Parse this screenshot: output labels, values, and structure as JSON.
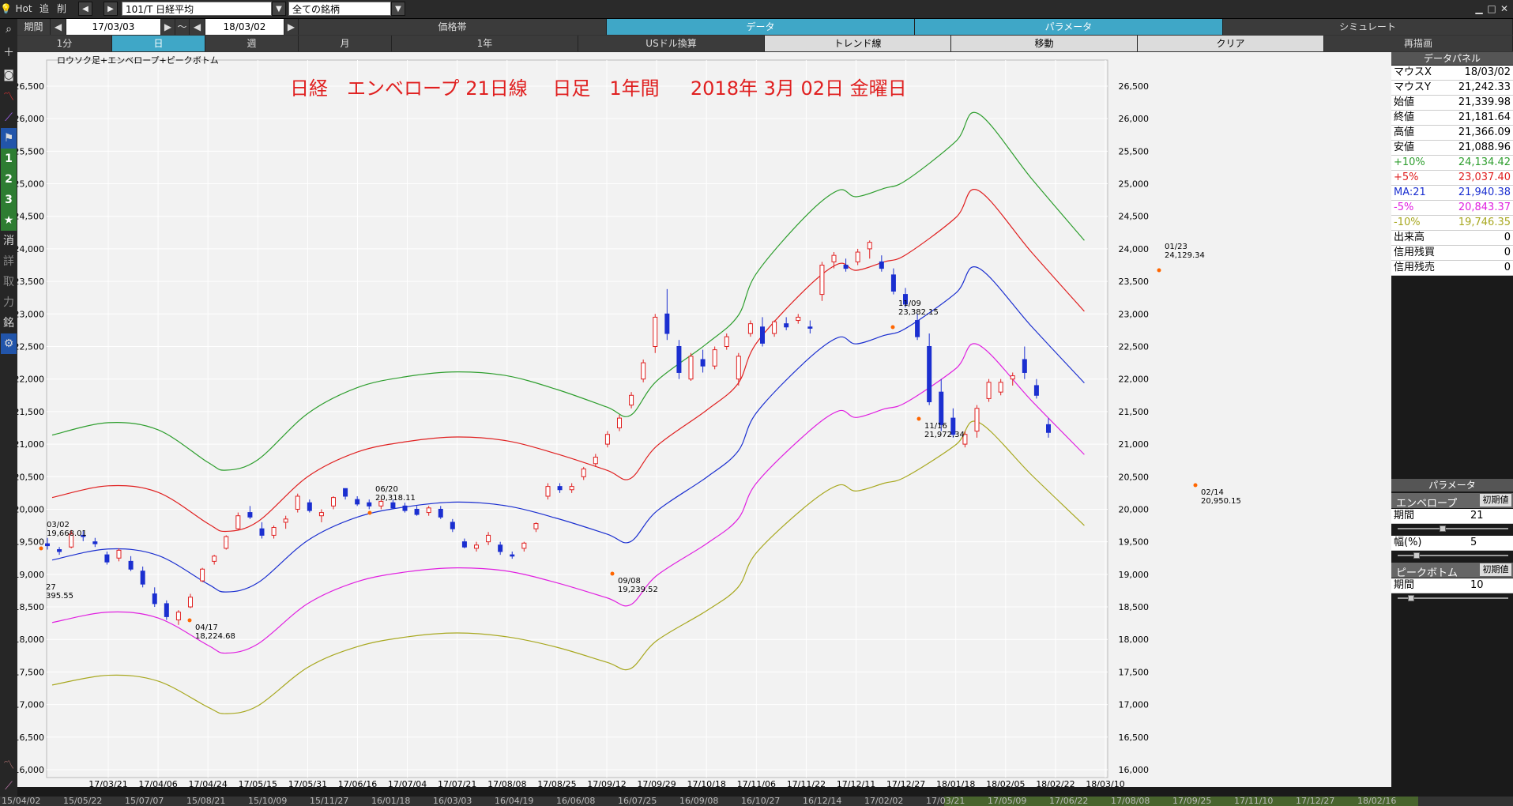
{
  "toolbar": {
    "hot": "Hot",
    "add": "追",
    "delete": "削",
    "symbol": "101/T 日経平均",
    "universe": "全ての銘柄",
    "period_label": "期間",
    "date_from": "17/03/03",
    "tilde": "～",
    "date_to": "18/03/02",
    "tabs": [
      "価格帯",
      "データ",
      "パラメータ",
      "シミュレート"
    ],
    "active_tabs": [
      1,
      2
    ],
    "timeframes": [
      "1分",
      "日",
      "週",
      "月",
      "1年",
      "USドル換算",
      "トレンド線",
      "移動",
      "クリア",
      "再描画"
    ],
    "active_timeframe": 1
  },
  "leftbar": {
    "icons": [
      "search-icon",
      "plus-icon",
      "camera-icon",
      "line-chart-icon",
      "trend-icon",
      "flag-icon"
    ],
    "numbers": [
      "1",
      "2",
      "3"
    ],
    "star": "★",
    "labels": [
      "消",
      "詳",
      "取",
      "力",
      "銘"
    ],
    "settings": "gear-icon"
  },
  "chart_data": {
    "type": "candlestick",
    "indicator_label": "ロウソク足+エンベロープ+ピークボトム",
    "title": "日経　エンベロープ 21日線　 日足　1年間 　 2018年 3月 02日 金曜日",
    "ylim": [
      16000,
      27000
    ],
    "yticks": [
      16000,
      16500,
      17000,
      17500,
      18000,
      18500,
      19000,
      19500,
      20000,
      20500,
      21000,
      21500,
      22000,
      22500,
      23000,
      23500,
      24000,
      24500,
      25000,
      25500,
      26000,
      26500
    ],
    "ytick_labels": [
      "16,000",
      "16,500",
      "17,000",
      "17,500",
      "18,000",
      "18,500",
      "19,000",
      "19,500",
      "20,000",
      "20,500",
      "21,000",
      "21,500",
      "22,000",
      "22,500",
      "23,000",
      "23,500",
      "24,000",
      "24,500",
      "25,000",
      "25,500",
      "26,000",
      "26,500"
    ],
    "xticks": [
      "17/03/21",
      "17/04/06",
      "17/04/24",
      "17/05/15",
      "17/05/31",
      "17/06/16",
      "17/07/04",
      "17/07/21",
      "17/08/08",
      "17/08/25",
      "17/09/12",
      "17/09/29",
      "17/10/18",
      "17/11/06",
      "17/11/22",
      "17/12/11",
      "17/12/27",
      "18/01/18",
      "18/02/05",
      "18/02/22",
      "18/03/10"
    ],
    "series": [
      {
        "name": "+10%",
        "color": "#2e9e2e",
        "values": [
          21140,
          21330,
          21220,
          20720,
          20600,
          20760,
          21470,
          21870,
          22040,
          22110,
          22050,
          21840,
          21570,
          21440,
          21970,
          22540,
          22970,
          23620,
          24510,
          24900,
          24800,
          24930,
          25050,
          25650,
          26080,
          25070,
          24130
        ]
      },
      {
        "name": "+5%",
        "color": "#e02020",
        "values": [
          20180,
          20360,
          20260,
          19780,
          19660,
          19810,
          20500,
          20880,
          21040,
          21110,
          21050,
          20850,
          20600,
          20470,
          20970,
          21520,
          21930,
          22550,
          23390,
          23770,
          23670,
          23800,
          23910,
          24480,
          24900,
          23940,
          23040
        ]
      },
      {
        "name": "MA:21",
        "color": "#1b2fd0",
        "values": [
          19220,
          19390,
          19290,
          18850,
          18730,
          18870,
          19520,
          19880,
          20040,
          20110,
          20050,
          19860,
          19620,
          19500,
          19970,
          20490,
          20890,
          21480,
          22280,
          22640,
          22540,
          22670,
          22780,
          23320,
          23710,
          22800,
          21940
        ]
      },
      {
        "name": "-5%",
        "color": "#e020e0",
        "values": [
          18260,
          18420,
          18330,
          17910,
          17790,
          17930,
          18550,
          18890,
          19040,
          19100,
          19050,
          18870,
          18640,
          18530,
          18980,
          19470,
          19850,
          20400,
          21160,
          21510,
          21410,
          21540,
          21640,
          22160,
          22530,
          21660,
          20840
        ]
      },
      {
        "name": "-10%",
        "color": "#a8a820",
        "values": [
          17300,
          17450,
          17360,
          16960,
          16860,
          16980,
          17570,
          17890,
          18040,
          18100,
          18040,
          17880,
          17650,
          17550,
          17980,
          18440,
          18800,
          19330,
          20050,
          20370,
          20280,
          20400,
          20500,
          20990,
          21340,
          20520,
          19750
        ]
      }
    ],
    "band_x_dates": [
      "17/03/03",
      "17/03/21",
      "17/04/06",
      "17/04/24",
      "17/05/01",
      "17/05/15",
      "17/05/31",
      "17/06/16",
      "17/07/04",
      "17/07/21",
      "17/08/08",
      "17/08/25",
      "17/09/12",
      "17/09/20",
      "17/09/29",
      "17/10/18",
      "17/10/30",
      "17/11/06",
      "17/11/22",
      "17/12/04",
      "17/12/11",
      "17/12/20",
      "17/12/27",
      "18/01/18",
      "18/01/26",
      "18/02/14",
      "18/03/02"
    ],
    "candles": [
      [
        19470,
        19560,
        19380,
        19440
      ],
      [
        19380,
        19420,
        19300,
        19350
      ],
      [
        19420,
        19680,
        19400,
        19620
      ],
      [
        19600,
        19668,
        19510,
        19580
      ],
      [
        19500,
        19560,
        19420,
        19470
      ],
      [
        19300,
        19350,
        19150,
        19190
      ],
      [
        19250,
        19400,
        19200,
        19370
      ],
      [
        19200,
        19280,
        19050,
        19080
      ],
      [
        19050,
        19120,
        18800,
        18850
      ],
      [
        18700,
        18800,
        18500,
        18550
      ],
      [
        18550,
        18600,
        18300,
        18350
      ],
      [
        18300,
        18450,
        18224,
        18420
      ],
      [
        18500,
        18700,
        18480,
        18650
      ],
      [
        18900,
        19100,
        18880,
        19080
      ],
      [
        19200,
        19300,
        19150,
        19280
      ],
      [
        19400,
        19600,
        19380,
        19580
      ],
      [
        19700,
        19950,
        19680,
        19900
      ],
      [
        19950,
        20050,
        19850,
        19880
      ],
      [
        19700,
        19800,
        19550,
        19600
      ],
      [
        19600,
        19750,
        19550,
        19720
      ],
      [
        19800,
        19900,
        19700,
        19850
      ],
      [
        20000,
        20240,
        19950,
        20200
      ],
      [
        20100,
        20150,
        19950,
        19980
      ],
      [
        19900,
        20000,
        19800,
        19950
      ],
      [
        20050,
        20200,
        20000,
        20180
      ],
      [
        20318,
        20318,
        20150,
        20200
      ],
      [
        20150,
        20200,
        20050,
        20080
      ],
      [
        20100,
        20150,
        20000,
        20050
      ],
      [
        20050,
        20150,
        20000,
        20120
      ],
      [
        20100,
        20150,
        20000,
        20020
      ],
      [
        20050,
        20100,
        19950,
        19980
      ],
      [
        20000,
        20050,
        19900,
        19920
      ],
      [
        19950,
        20050,
        19900,
        20020
      ],
      [
        20000,
        20050,
        19850,
        19880
      ],
      [
        19800,
        19850,
        19650,
        19700
      ],
      [
        19500,
        19550,
        19400,
        19420
      ],
      [
        19400,
        19500,
        19350,
        19450
      ],
      [
        19500,
        19650,
        19450,
        19600
      ],
      [
        19450,
        19500,
        19300,
        19350
      ],
      [
        19300,
        19350,
        19240,
        19280
      ],
      [
        19400,
        19500,
        19350,
        19480
      ],
      [
        19700,
        19800,
        19650,
        19780
      ],
      [
        20200,
        20400,
        20150,
        20350
      ],
      [
        20350,
        20400,
        20250,
        20300
      ],
      [
        20300,
        20400,
        20250,
        20350
      ],
      [
        20500,
        20650,
        20450,
        20620
      ],
      [
        20700,
        20850,
        20650,
        20800
      ],
      [
        21000,
        21200,
        20950,
        21150
      ],
      [
        21250,
        21450,
        21200,
        21400
      ],
      [
        21600,
        21800,
        21550,
        21750
      ],
      [
        22000,
        22300,
        21950,
        22250
      ],
      [
        22500,
        23000,
        22400,
        22950
      ],
      [
        23000,
        23382,
        22600,
        22700
      ],
      [
        22500,
        22600,
        22000,
        22100
      ],
      [
        22000,
        22400,
        21972,
        22350
      ],
      [
        22300,
        22450,
        22100,
        22200
      ],
      [
        22200,
        22500,
        22150,
        22450
      ],
      [
        22500,
        22700,
        22450,
        22650
      ],
      [
        22000,
        22400,
        21900,
        22350
      ],
      [
        22700,
        22900,
        22650,
        22850
      ],
      [
        22800,
        22950,
        22500,
        22550
      ],
      [
        22700,
        22900,
        22650,
        22880
      ],
      [
        22850,
        22950,
        22750,
        22800
      ],
      [
        22900,
        23000,
        22850,
        22950
      ],
      [
        22800,
        22900,
        22700,
        22780
      ],
      [
        23300,
        23800,
        23200,
        23750
      ],
      [
        23800,
        23950,
        23700,
        23900
      ],
      [
        23750,
        23850,
        23650,
        23700
      ],
      [
        23800,
        24000,
        23750,
        23950
      ],
      [
        24000,
        24129,
        23850,
        24100
      ],
      [
        23800,
        23900,
        23650,
        23700
      ],
      [
        23600,
        23700,
        23300,
        23350
      ],
      [
        23300,
        23400,
        23100,
        23150
      ],
      [
        22900,
        23000,
        22600,
        22650
      ],
      [
        22500,
        22700,
        21600,
        21650
      ],
      [
        21800,
        22000,
        21200,
        21300
      ],
      [
        21400,
        21550,
        21100,
        21150
      ],
      [
        21000,
        21200,
        20950,
        21150
      ],
      [
        21200,
        21600,
        21100,
        21550
      ],
      [
        21700,
        22000,
        21650,
        21950
      ],
      [
        21800,
        22000,
        21750,
        21950
      ],
      [
        22000,
        22100,
        21900,
        22050
      ],
      [
        22300,
        22500,
        22000,
        22100
      ],
      [
        21900,
        22000,
        21700,
        21750
      ],
      [
        21300,
        21400,
        21100,
        21180
      ]
    ],
    "annotations": [
      {
        "date": "03/02",
        "value": "19,668.01"
      },
      {
        "date": "04/17",
        "value": "18,224.68"
      },
      {
        "date": "06/20",
        "value": "20,318.11"
      },
      {
        "date": "09/08",
        "value": "19,239.52"
      },
      {
        "date": "11/09",
        "value": "23,382.15"
      },
      {
        "date": "11/16",
        "value": "21,972.34"
      },
      {
        "date": "01/23",
        "value": "24,129.34"
      },
      {
        "date": "02/14",
        "value": "20,950.15"
      }
    ],
    "clipped_left_annotation": {
      "date": "27",
      "value": "395.55"
    },
    "colors": {
      "bull": "#e02020",
      "bear": "#1b2fd0",
      "peak": "#ff6600",
      "background": "#f2f2f2",
      "grid": "#ffffff",
      "title": "#e02020"
    },
    "grid": true
  },
  "panel": {
    "data_header": "データパネル",
    "rows": [
      {
        "label": "マウスX",
        "value": "18/03/02",
        "color": "#000000"
      },
      {
        "label": "マウスY",
        "value": "21,242.33",
        "color": "#000000"
      },
      {
        "label": "始値",
        "value": "21,339.98",
        "color": "#000000"
      },
      {
        "label": "終値",
        "value": "21,181.64",
        "color": "#000000"
      },
      {
        "label": "高値",
        "value": "21,366.09",
        "color": "#000000"
      },
      {
        "label": "安値",
        "value": "21,088.96",
        "color": "#000000"
      },
      {
        "label": "+10%",
        "value": "24,134.42",
        "color": "#2e9e2e"
      },
      {
        "label": "+5%",
        "value": "23,037.40",
        "color": "#e02020"
      },
      {
        "label": "MA:21",
        "value": "21,940.38",
        "color": "#1b2fd0"
      },
      {
        "label": "-5%",
        "value": "20,843.37",
        "color": "#e020e0"
      },
      {
        "label": "-10%",
        "value": "19,746.35",
        "color": "#a8a820"
      },
      {
        "label": "出来高",
        "value": "0",
        "color": "#000000"
      },
      {
        "label": "信用残買",
        "value": "0",
        "color": "#000000"
      },
      {
        "label": "信用残売",
        "value": "0",
        "color": "#000000"
      }
    ],
    "param_header": "パラメータ",
    "envelope": {
      "name": "エンベロープ",
      "reset": "初期値",
      "period_label": "期間",
      "period_value": "21",
      "width_label": "幅(%)",
      "width_value": "5",
      "period_slider": 0.4,
      "width_slider": 0.15
    },
    "peakbottom": {
      "name": "ピークボトム",
      "reset": "初期値",
      "period_label": "期間",
      "period_value": "10",
      "period_slider": 0.1
    }
  },
  "bottombar": {
    "dates": [
      "15/04/02",
      "15/05/22",
      "15/07/07",
      "15/08/21",
      "15/10/09",
      "15/11/27",
      "16/01/18",
      "16/03/03",
      "16/04/19",
      "16/06/08",
      "16/07/25",
      "16/09/08",
      "16/10/27",
      "16/12/14",
      "17/02/02",
      "17/03/21",
      "17/05/09",
      "17/06/22",
      "17/08/08",
      "17/09/25",
      "17/11/10",
      "17/12/27",
      "18/02/16"
    ]
  }
}
